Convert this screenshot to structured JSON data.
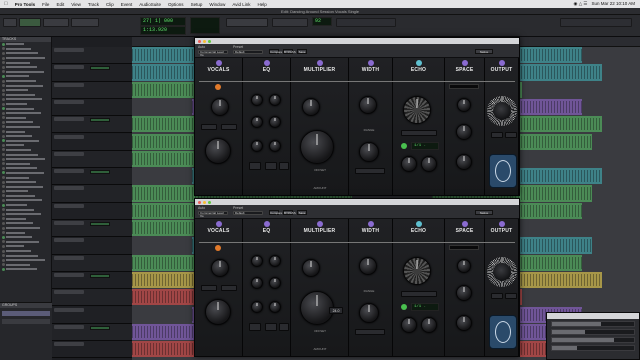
{
  "menubar": {
    "app": "Pro Tools",
    "items": [
      "File",
      "Edit",
      "View",
      "Track",
      "Clip",
      "Event",
      "AudioSuite",
      "Options",
      "Setup",
      "Window",
      "Avid Link",
      "Help"
    ],
    "clock": "Sun Mar 22  10:10 AM"
  },
  "window_title": "Edit: Dancing Around Session Vocals Single",
  "transport": {
    "main_counter": "27| 1| 000",
    "sub_counter": "1:13.920",
    "tempo": "92"
  },
  "tracks_panel": {
    "header": "TRACKS",
    "groups_header": "GROUPS"
  },
  "plugins": [
    {
      "preset_label": "Preset",
      "auto_label": "Auto",
      "track_sel": "Commercial Lead Vo",
      "preset_sel": "Default",
      "compare": "Compare",
      "bypass": "BYPASS",
      "save": "Save",
      "native": "Native"
    },
    {
      "preset_label": "Preset",
      "auto_label": "Auto",
      "track_sel": "Commercial Lead Vo",
      "preset_sel": "Default",
      "compare": "Compare",
      "bypass": "BYPASS",
      "save": "Save",
      "native": "Native"
    }
  ],
  "modules": {
    "vocals": "VOCALS",
    "eq": "EQ",
    "multiplier": "MULTIPLIER",
    "width": "WIDTH",
    "echo": "ECHO",
    "space": "SPACE",
    "output": "OUTPUT"
  },
  "knob_labels": {
    "offset": "OFFSET",
    "amount": "AMOUNT",
    "range": "RANGE",
    "mix": "MIX",
    "decay": "DECAY",
    "lo_cut": "LO CUT",
    "hi_cut": "HI CUT",
    "lo_boost": "LO BOOST",
    "presence": "PRES"
  },
  "echo_display": "1/1 .",
  "multiplier_value": "24.0",
  "colors": {
    "accent_purple": "#8a6bd0",
    "accent_orange": "#e27a2a",
    "accent_green": "#49c04f",
    "clip_green": "#4e9a5a",
    "clip_purple": "#7a5aa8",
    "clip_teal": "#3f8f95",
    "clip_red": "#b34848",
    "clip_yellow": "#b9a64a"
  }
}
